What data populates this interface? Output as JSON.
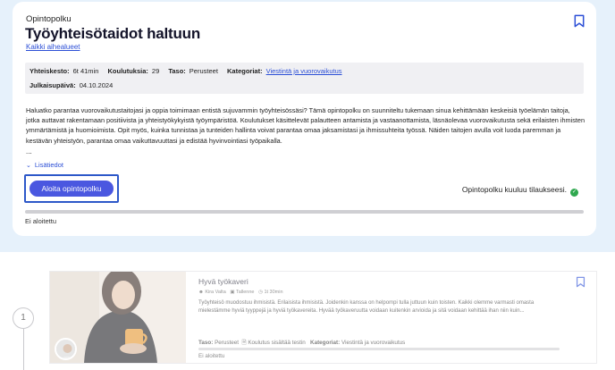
{
  "header": {
    "eyebrow": "Opintopolku",
    "title": "Työyhteisötaidot haltuun",
    "all_topics_link": "Kaikki aihealueet"
  },
  "meta": {
    "duration_label": "Yhteiskesto:",
    "duration_value": "6t 41min",
    "courses_label": "Koulutuksia:",
    "courses_value": "29",
    "level_label": "Taso:",
    "level_value": "Perusteet",
    "categories_label": "Kategoriat:",
    "categories_value": "Viestintä ja vuorovaikutus",
    "published_label": "Julkaisupäivä:",
    "published_value": "04.10.2024"
  },
  "description": "Haluatko parantaa vuorovaikutustaitojasi ja oppia toimimaan entistä sujuvammin työyhteisössäsi? Tämä opintopolku on suunniteltu tukemaan sinua kehittämään keskeisiä työelämän taitoja, jotka auttavat rakentamaan positiivista ja yhteistyökykyistä työympäristöä. Koulutukset käsittelevät palautteen antamista ja vastaanottamista, läsnäolevaa vuorovaikutusta sekä erilaisten ihmisten ymmärtämistä ja huomioimista. Opit myös, kuinka tunnistaa ja tunteiden hallinta voivat parantaa omaa jaksamistasi ja ihmissuhteita työssä. Näiden taitojen avulla voit luoda paremman ja kestävän yhteistyön, parantaa omaa vaikuttavuuttasi ja edistää hyvinvointiasi työpaikalla.",
  "ellipsis": "...",
  "more_link": "Lisätiedot",
  "start_button": "Aloita opintopolku",
  "subscription_note": "Opintopolku kuuluu tilaukseesi.",
  "progress": {
    "value": 0.0
  },
  "status": "Ei aloitettu",
  "step_number": "1",
  "course": {
    "title": "Hyvä työkaveri",
    "author": "Kira Valta",
    "type": "Tallenne",
    "duration": "1t 30min",
    "description": "Työyhteisö muodostuu ihmisistä. Erilaisista ihmisistä. Joidenkin kanssa on helpompi tulla juttuun kuin toisten. Kaikki olemme varmasti omasta mielestämme hyviä tyyppejä ja hyviä työkavereita. Hyvää työkaveruutta voidaan kuitenkin arvioida ja sitä voidaan kehittää ihan niin kuin...",
    "level_label": "Taso:",
    "level_value": "Perusteet",
    "includes_test": "Koulutus sisältää testin",
    "categories_label": "Kategoriat:",
    "categories_value": "Viestintä ja vuorovaikutus",
    "status": "Ei aloitettu"
  },
  "colors": {
    "accent": "#4a57e0",
    "link": "#2c4fd6",
    "focus": "#2d58c9",
    "success": "#2fa84f",
    "background": "#e6f1fb"
  }
}
